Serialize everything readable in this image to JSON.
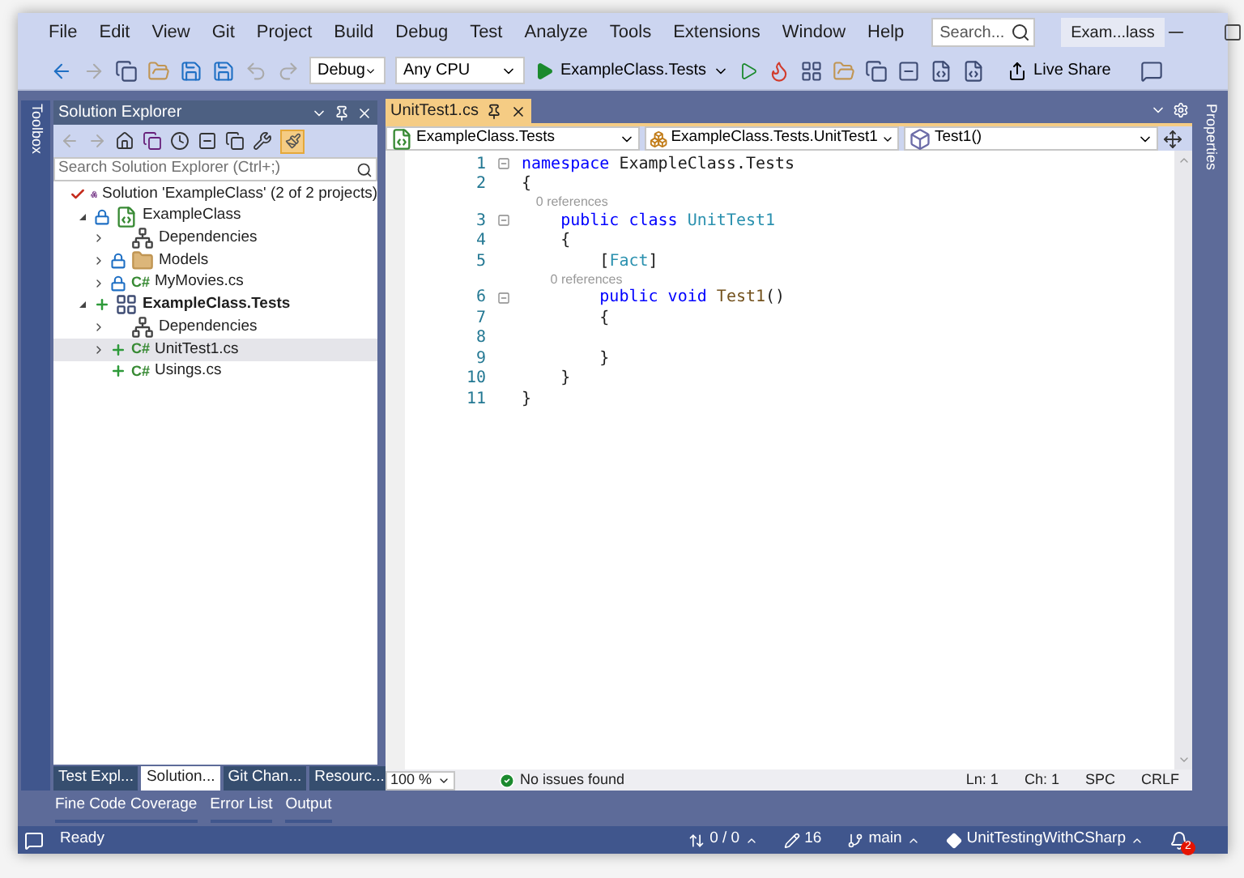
{
  "menu": [
    "File",
    "Edit",
    "View",
    "Git",
    "Project",
    "Build",
    "Debug",
    "Test",
    "Analyze",
    "Tools",
    "Extensions",
    "Window",
    "Help"
  ],
  "search": {
    "placeholder": "Search..."
  },
  "title_badge": "Exam...lass",
  "toolbar": {
    "configuration": "Debug",
    "platform": "Any CPU",
    "startup": "ExampleClass.Tests",
    "live_share": "Live Share"
  },
  "left_strip": "Toolbox",
  "solution_explorer": {
    "title": "Solution Explorer",
    "search_placeholder": "Search Solution Explorer (Ctrl+;)",
    "tree": [
      {
        "label": "Solution 'ExampleClass' (2 of 2 projects)",
        "kind": "solution",
        "checked": true,
        "locked": false,
        "added": false,
        "bold": false,
        "selected": false,
        "children": [
          {
            "label": "ExampleClass",
            "kind": "project",
            "checked": false,
            "locked": true,
            "added": false,
            "expanded": true,
            "bold": false,
            "selected": false,
            "children": [
              {
                "label": "Dependencies",
                "kind": "dependencies",
                "checked": false,
                "locked": false,
                "added": false,
                "expanded": false,
                "bold": false,
                "selected": false
              },
              {
                "label": "Models",
                "kind": "folder",
                "checked": false,
                "locked": true,
                "added": false,
                "expanded": false,
                "bold": false,
                "selected": false
              },
              {
                "label": "MyMovies.cs",
                "kind": "file",
                "badge": "C#",
                "checked": false,
                "locked": true,
                "added": false,
                "expanded": false,
                "bold": false,
                "selected": false
              }
            ]
          },
          {
            "label": "ExampleClass.Tests",
            "kind": "test-project",
            "checked": false,
            "locked": false,
            "added": true,
            "expanded": true,
            "bold": true,
            "selected": false,
            "children": [
              {
                "label": "Dependencies",
                "kind": "dependencies",
                "checked": false,
                "locked": false,
                "added": false,
                "expanded": false,
                "bold": false,
                "selected": false
              },
              {
                "label": "UnitTest1.cs",
                "kind": "file",
                "badge": "C#",
                "checked": false,
                "locked": false,
                "added": true,
                "expanded": false,
                "bold": false,
                "selected": true
              },
              {
                "label": "Usings.cs",
                "kind": "file",
                "badge": "C#",
                "checked": false,
                "locked": false,
                "added": true,
                "bold": false,
                "selected": false
              }
            ]
          }
        ]
      }
    ]
  },
  "left_tabs": [
    {
      "label": "Test Expl...",
      "selected": false
    },
    {
      "label": "Solution...",
      "selected": true
    },
    {
      "label": "Git Chan...",
      "selected": false
    },
    {
      "label": "Resourc...",
      "selected": false
    }
  ],
  "editor": {
    "tabs": [
      {
        "label": "UnitTest1.cs",
        "selected": true
      }
    ],
    "nav": [
      {
        "label": "ExampleClass.Tests",
        "kind": "project"
      },
      {
        "label": "ExampleClass.Tests.UnitTest1",
        "kind": "class"
      },
      {
        "label": "Test1()",
        "kind": "method"
      }
    ],
    "lines": [
      {
        "kind": "code",
        "number": "1",
        "fold": true,
        "tokens": [
          {
            "text": "namespace",
            "kind": "keyword"
          },
          {
            "text": " ExampleClass.Tests",
            "kind": "plain"
          }
        ]
      },
      {
        "kind": "code",
        "number": "2",
        "fold": false,
        "tokens": [
          {
            "text": "{",
            "kind": "plain"
          }
        ]
      },
      {
        "kind": "lens",
        "text": "    0 references"
      },
      {
        "kind": "code",
        "number": "3",
        "fold": true,
        "tokens": [
          {
            "text": "    public class ",
            "kind": "keyword"
          },
          {
            "text": "UnitTest1",
            "kind": "type"
          }
        ]
      },
      {
        "kind": "code",
        "number": "4",
        "fold": false,
        "tokens": [
          {
            "text": "    {",
            "kind": "plain"
          }
        ]
      },
      {
        "kind": "code",
        "number": "5",
        "fold": false,
        "tokens": [
          {
            "text": "        [",
            "kind": "plain"
          },
          {
            "text": "Fact",
            "kind": "type"
          },
          {
            "text": "]",
            "kind": "plain"
          }
        ]
      },
      {
        "kind": "lens",
        "text": "        0 references"
      },
      {
        "kind": "code",
        "number": "6",
        "fold": true,
        "tokens": [
          {
            "text": "        public void ",
            "kind": "keyword"
          },
          {
            "text": "Test1",
            "kind": "method"
          },
          {
            "text": "()",
            "kind": "plain"
          }
        ]
      },
      {
        "kind": "code",
        "number": "7",
        "fold": false,
        "tokens": [
          {
            "text": "        {",
            "kind": "plain"
          }
        ]
      },
      {
        "kind": "code",
        "number": "8",
        "fold": false
      },
      {
        "kind": "code",
        "number": "9",
        "fold": false,
        "tokens": [
          {
            "text": "        }",
            "kind": "plain"
          }
        ]
      },
      {
        "kind": "code",
        "number": "10",
        "fold": false,
        "tokens": [
          {
            "text": "    }",
            "kind": "plain"
          }
        ]
      },
      {
        "kind": "code",
        "number": "11",
        "fold": false,
        "tokens": [
          {
            "text": "}",
            "kind": "plain"
          }
        ]
      }
    ],
    "zoom": "100 %",
    "issues": "No issues found",
    "ln": "Ln: 1",
    "ch": "Ch: 1",
    "spc": "SPC",
    "crlf": "CRLF"
  },
  "right_strip": "Properties",
  "tool_tabs": [
    "Fine Code Coverage",
    "Error List",
    "Output"
  ],
  "status_bar": {
    "ready": "Ready",
    "changes": "0 / 0",
    "edits": "16",
    "branch": "main",
    "repo": "UnitTestingWithCSharp",
    "notifications": "2"
  }
}
